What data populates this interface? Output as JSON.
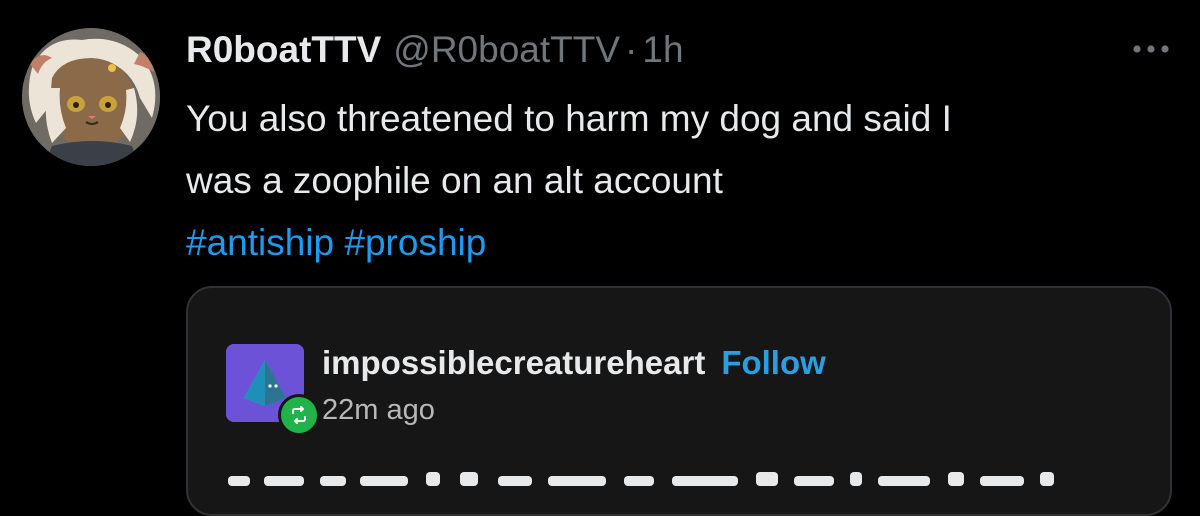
{
  "tweet": {
    "display_name": "R0boatTTV",
    "handle": "@R0boatTTV",
    "separator": "·",
    "time": "1h",
    "text_line1": "You also threatened to harm my dog and said I",
    "text_line2": "was a zoophile on an alt account",
    "hashtags": [
      "#antiship",
      "#proship"
    ],
    "more_icon": "more-horizontal-icon"
  },
  "embed": {
    "username": "impossiblecreatureheart",
    "follow_label": "Follow",
    "time": "22m ago",
    "avatar_icon": "pyramid-icon",
    "badge_icon": "reblog-icon"
  },
  "colors": {
    "background": "#000000",
    "text": "#e7e9ea",
    "muted": "#71767b",
    "hashtag": "#1d9bf0",
    "follow": "#2a9fe0",
    "embed_bg": "#161616",
    "tumblr_avatar": "#6b52d6",
    "reblog_badge": "#1fb34a"
  }
}
